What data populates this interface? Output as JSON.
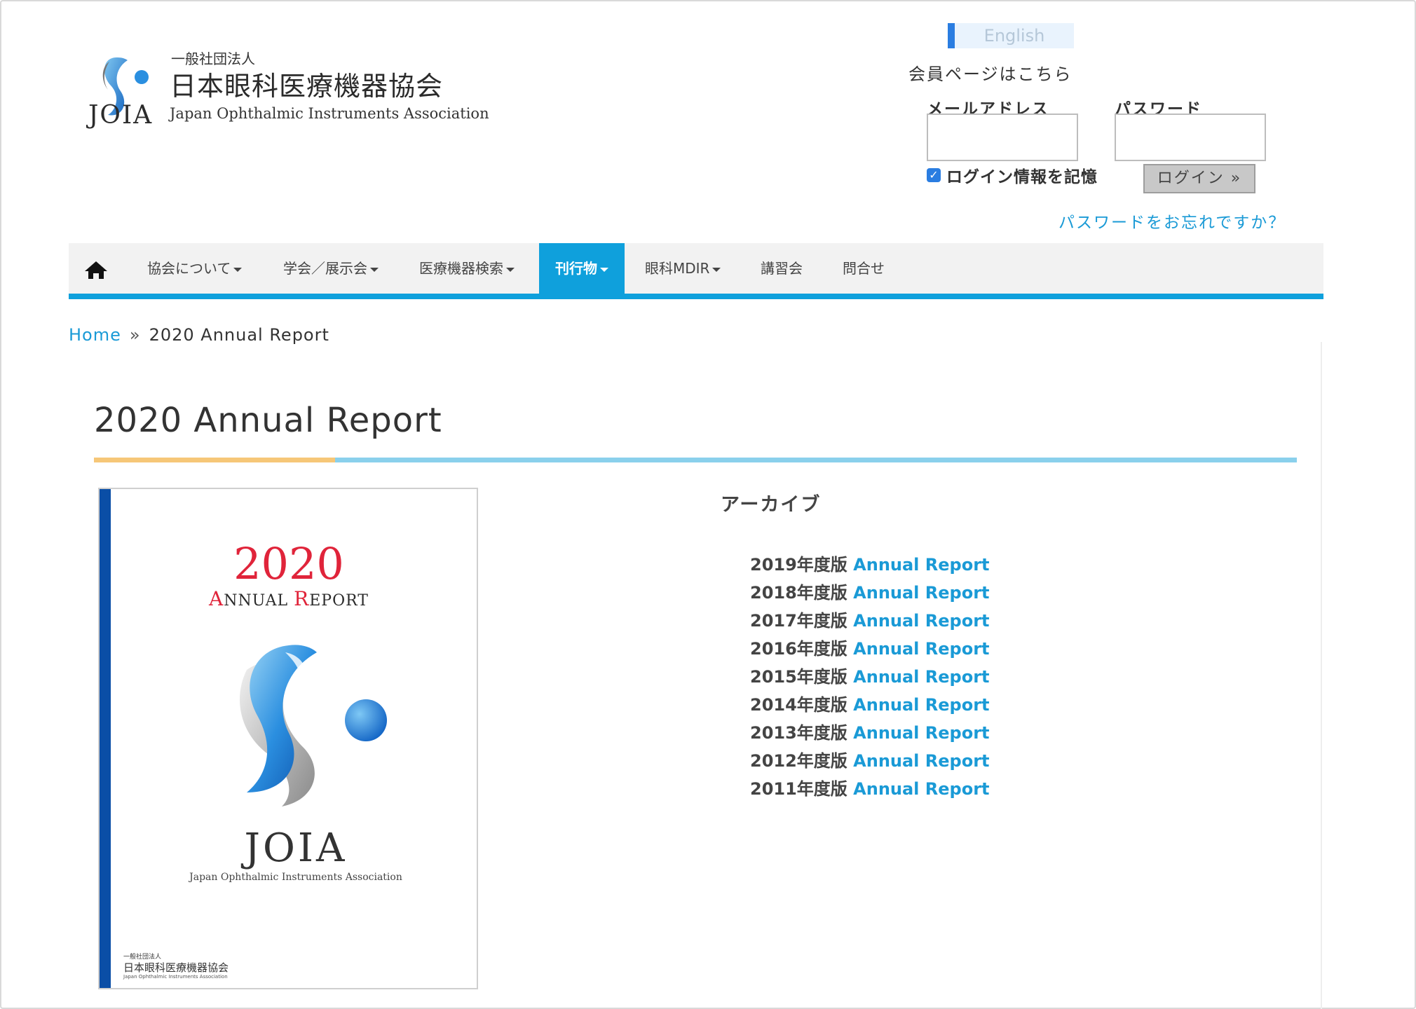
{
  "header": {
    "logo_sub": "一般社団法人",
    "logo_name": "日本眼科医療機器協会",
    "logo_abbr": "JOIA",
    "logo_en": "Japan Ophthalmic Instruments Association",
    "language_button": "English",
    "member_title": "会員ページはこちら",
    "email_label": "メールアドレス",
    "password_label": "パスワード",
    "email_value": "",
    "password_value": "",
    "remember_label": "ログイン情報を記憶",
    "remember_checked": true,
    "login_button": "ログイン »",
    "forgot_link": "パスワードをお忘れですか？"
  },
  "nav": {
    "home_icon": "home-icon",
    "items": [
      {
        "label": "協会について",
        "dropdown": true,
        "active": false
      },
      {
        "label": "学会／展示会",
        "dropdown": true,
        "active": false
      },
      {
        "label": "医療機器検索",
        "dropdown": true,
        "active": false
      },
      {
        "label": "刊行物",
        "dropdown": true,
        "active": true
      },
      {
        "label": "眼科MDIR",
        "dropdown": true,
        "active": false
      },
      {
        "label": "講習会",
        "dropdown": false,
        "active": false
      },
      {
        "label": "問合せ",
        "dropdown": false,
        "active": false
      }
    ]
  },
  "breadcrumb": {
    "home": "Home",
    "separator": "»",
    "current": "2020 Annual Report"
  },
  "page": {
    "title": "2020 Annual Report"
  },
  "cover": {
    "year": "2020",
    "report_a": "A",
    "report_nnual": "NNUAL ",
    "report_r": "R",
    "report_eport": "EPORT",
    "abbr": "JOIA",
    "en": "Japan Ophthalmic Instruments Association",
    "small_sub": "一般社団法人",
    "small_name": "日本眼科医療機器協会",
    "small_en": "Japan Ophthalmic Instruments Association"
  },
  "archive": {
    "title": "アーカイブ",
    "link_text": "Annual Report",
    "items": [
      {
        "year": "2019年度版 "
      },
      {
        "year": "2018年度版 "
      },
      {
        "year": "2017年度版 "
      },
      {
        "year": "2016年度版 "
      },
      {
        "year": "2015年度版 "
      },
      {
        "year": "2014年度版 "
      },
      {
        "year": "2013年度版 "
      },
      {
        "year": "2012年度版 "
      },
      {
        "year": "2011年度版 "
      }
    ]
  },
  "colors": {
    "accent_blue": "#0fa0dc",
    "link_blue": "#1a9ad6",
    "title_orange": "#f6c778",
    "title_blue": "#8ad0ec",
    "cover_red": "#e0243a",
    "cover_spine": "#0a4ea6"
  }
}
